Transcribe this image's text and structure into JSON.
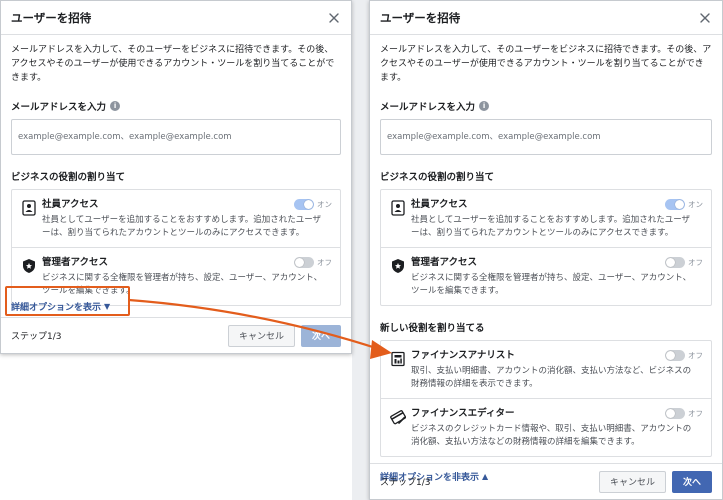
{
  "left": {
    "title": "ユーザーを招待",
    "description": "メールアドレスを入力して、そのユーザーをビジネスに招待できます。その後、アクセスやそのユーザーが使用できるアカウント・ツールを割り当てることができます。",
    "email_label": "メールアドレスを入力",
    "email_placeholder": "example@example.com、example@example.com",
    "roles_title": "ビジネスの役割の割り当て",
    "roles": [
      {
        "name": "社員アクセス",
        "desc": "社員としてユーザーを追加することをおすすめします。追加されたユーザーは、割り当てられたアカウントとツールのみにアクセスできます。",
        "toggle": "オン"
      },
      {
        "name": "管理者アクセス",
        "desc": "ビジネスに関する全権限を管理者が持ち、設定、ユーザー、アカウント、ツールを編集できます。",
        "toggle": "オフ"
      }
    ],
    "advanced_link": "詳細オプションを表示",
    "step": "ステップ1/3",
    "cancel_label": "キャンセル",
    "next_label": "次へ"
  },
  "right": {
    "title": "ユーザーを招待",
    "description": "メールアドレスを入力して、そのユーザーをビジネスに招待できます。その後、アクセスやそのユーザーが使用できるアカウント・ツールを割り当てることができます。",
    "email_label": "メールアドレスを入力",
    "email_placeholder": "example@example.com、example@example.com",
    "roles_title": "ビジネスの役割の割り当て",
    "roles": [
      {
        "name": "社員アクセス",
        "desc": "社員としてユーザーを追加することをおすすめします。追加されたユーザーは、割り当てられたアカウントとツールのみにアクセスできます。",
        "toggle": "オン"
      },
      {
        "name": "管理者アクセス",
        "desc": "ビジネスに関する全権限を管理者が持ち、設定、ユーザー、アカウント、ツールを編集できます。",
        "toggle": "オフ"
      }
    ],
    "new_roles_title": "新しい役割を割り当てる",
    "new_roles": [
      {
        "name": "ファイナンスアナリスト",
        "desc": "取引、支払い明細書、アカウントの消化額、支払い方法など、ビジネスの財務情報の詳細を表示できます。",
        "toggle": "オフ"
      },
      {
        "name": "ファイナンスエディター",
        "desc": "ビジネスのクレジットカード情報や、取引、支払い明細書、アカウントの消化額、支払い方法などの財務情報の詳細を編集できます。",
        "toggle": "オフ"
      }
    ],
    "advanced_link": "詳細オプションを非表示",
    "step": "ステップ1/3",
    "cancel_label": "キャンセル",
    "next_label": "次へ"
  },
  "colors": {
    "accent": "#4267b2",
    "link": "#365899",
    "highlight": "#e35d1c"
  }
}
